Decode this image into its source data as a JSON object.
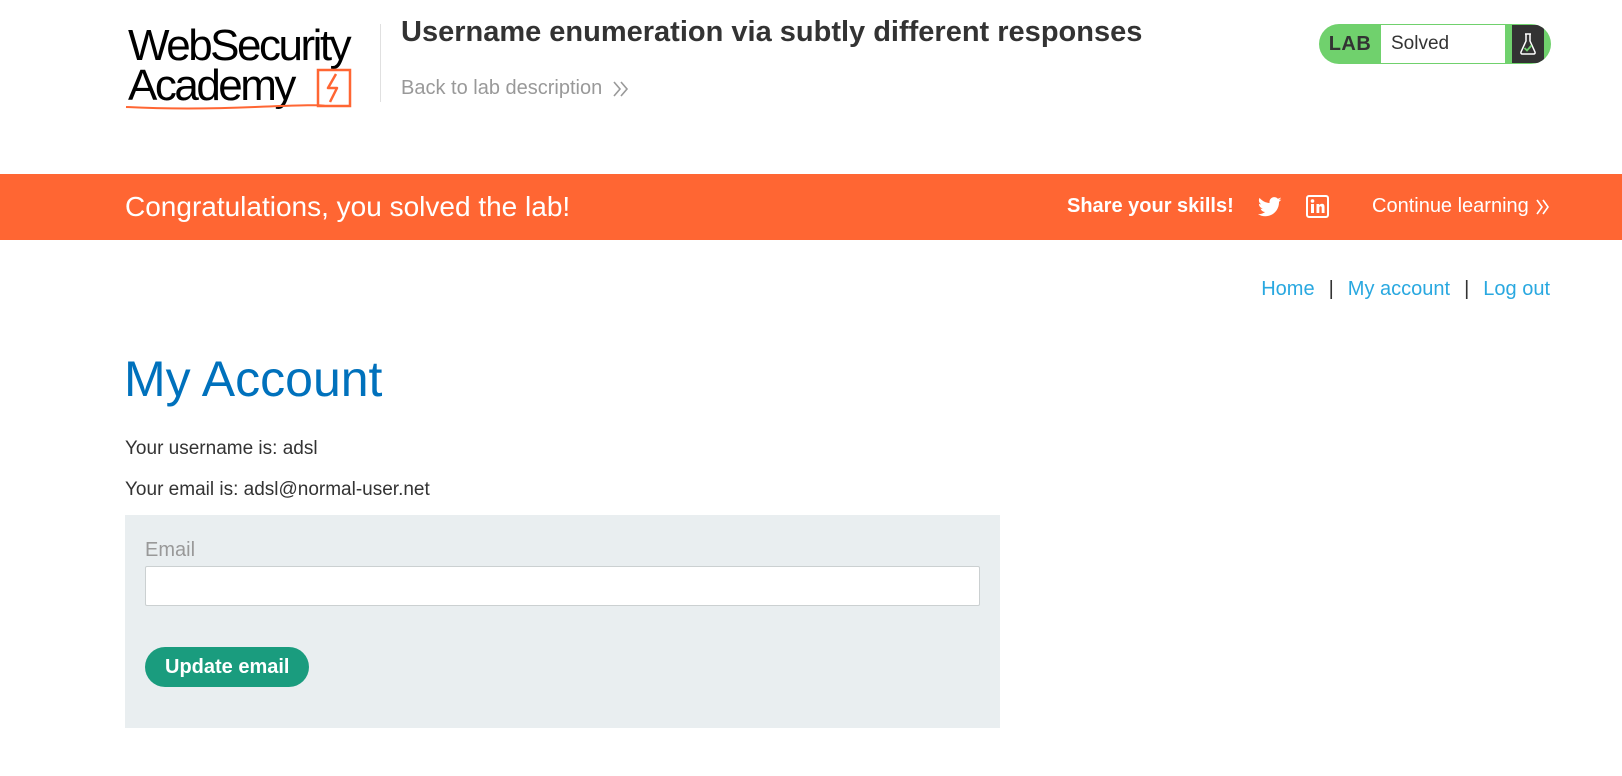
{
  "header": {
    "logo": {
      "line1": "WebSecurity",
      "line2": "Academy",
      "accent_color": "#ff6633"
    },
    "lab_title": "Username enumeration via subtly different responses",
    "back_link": {
      "label": "Back to lab description",
      "icon": "double-chevron-right-icon"
    },
    "lab_status": {
      "tag": "LAB",
      "state": "Solved",
      "icon": "flask-icon",
      "color": "#70d16d"
    }
  },
  "banner": {
    "message": "Congratulations, you solved the lab!",
    "share_label": "Share your skills!",
    "social_icons": [
      "twitter-icon",
      "linkedin-icon"
    ],
    "continue_label": "Continue learning",
    "color": "#ff6633"
  },
  "nav": {
    "home": "Home",
    "my_account": "My account",
    "log_out": "Log out",
    "separator": "|"
  },
  "main": {
    "title": "My Account",
    "username_line": "Your username is: adsl",
    "email_line": "Your email is: adsl@normal-user.net",
    "form": {
      "email_label": "Email",
      "email_value": "",
      "submit_label": "Update email",
      "button_color": "#1a9c7e"
    }
  }
}
